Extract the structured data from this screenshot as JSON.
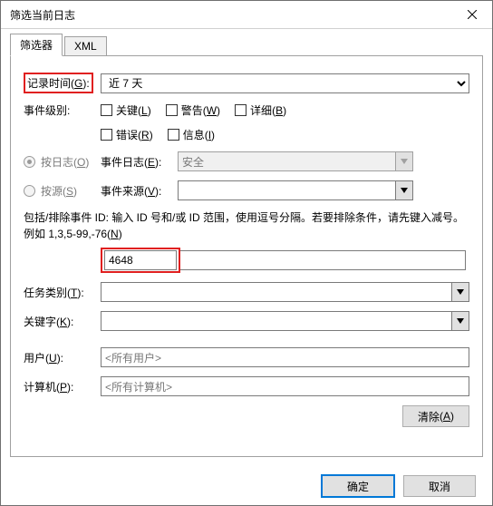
{
  "title": "筛选当前日志",
  "tabs": {
    "filter": "筛选器",
    "xml": "XML"
  },
  "labels": {
    "logged": "记录时间",
    "logged_key": "G",
    "level": "事件级别:",
    "by_log": "按日志",
    "by_log_key": "O",
    "by_source": "按源",
    "by_source_key": "S",
    "event_log": "事件日志",
    "event_log_key": "E",
    "event_source": "事件来源",
    "event_source_key": "V",
    "task": "任务类别",
    "task_key": "T",
    "keywords": "关键字",
    "keywords_key": "K",
    "user": "用户",
    "user_key": "U",
    "computer": "计算机",
    "computer_key": "P"
  },
  "time_options": {
    "selected": "近 7 天"
  },
  "levels": {
    "critical": "关键",
    "critical_key": "L",
    "warning": "警告",
    "warning_key": "W",
    "verbose": "详细",
    "verbose_key": "B",
    "error": "错误",
    "error_key": "R",
    "info": "信息",
    "info_key": "I"
  },
  "event_log_value": "安全",
  "help_text": "包括/排除事件 ID: 输入 ID 号和/或 ID 范围，使用逗号分隔。若要排除条件，请先键入减号。例如 1,3,5-99,-76",
  "help_key": "N",
  "id_value": "4648",
  "user_value": "<所有用户>",
  "computer_value": "<所有计算机>",
  "buttons": {
    "clear": "清除",
    "clear_key": "A",
    "ok": "确定",
    "cancel": "取消"
  }
}
